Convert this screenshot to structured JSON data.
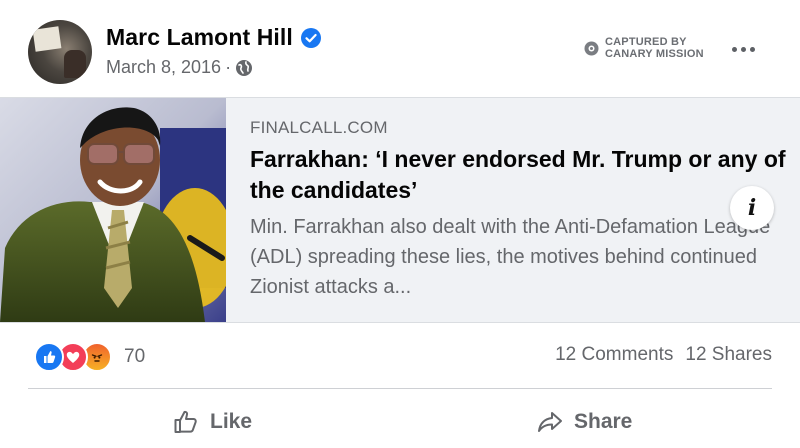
{
  "post": {
    "author": "Marc Lamont Hill",
    "date": "March 8, 2016",
    "separator": "·",
    "captured_line1": "CAPTURED BY",
    "captured_line2": "CANARY MISSION"
  },
  "link": {
    "domain": "FINALCALL.COM",
    "headline": "Farrakhan: ‘I never endorsed Mr. Trump or any of the candidates’",
    "description": "Min. Farrakhan also dealt with the Anti-Defamation League (ADL) spreading these lies, the motives behind continued Zionist attacks a...",
    "info_glyph": "i"
  },
  "engagement": {
    "reaction_count": "70",
    "comments": "12 Comments",
    "shares": "12 Shares"
  },
  "actions": {
    "like_label": "Like",
    "share_label": "Share"
  },
  "icons": {
    "verified": "verified-badge-icon",
    "privacy": "globe-icon",
    "more": "more-options-icon",
    "like_reaction": "like-reaction-icon",
    "love_reaction": "love-reaction-icon",
    "angry_reaction": "angry-reaction-icon"
  },
  "colors": {
    "brand_blue": "#1877f2",
    "secondary_text": "#65676b",
    "preview_bg": "#f0f2f5"
  }
}
